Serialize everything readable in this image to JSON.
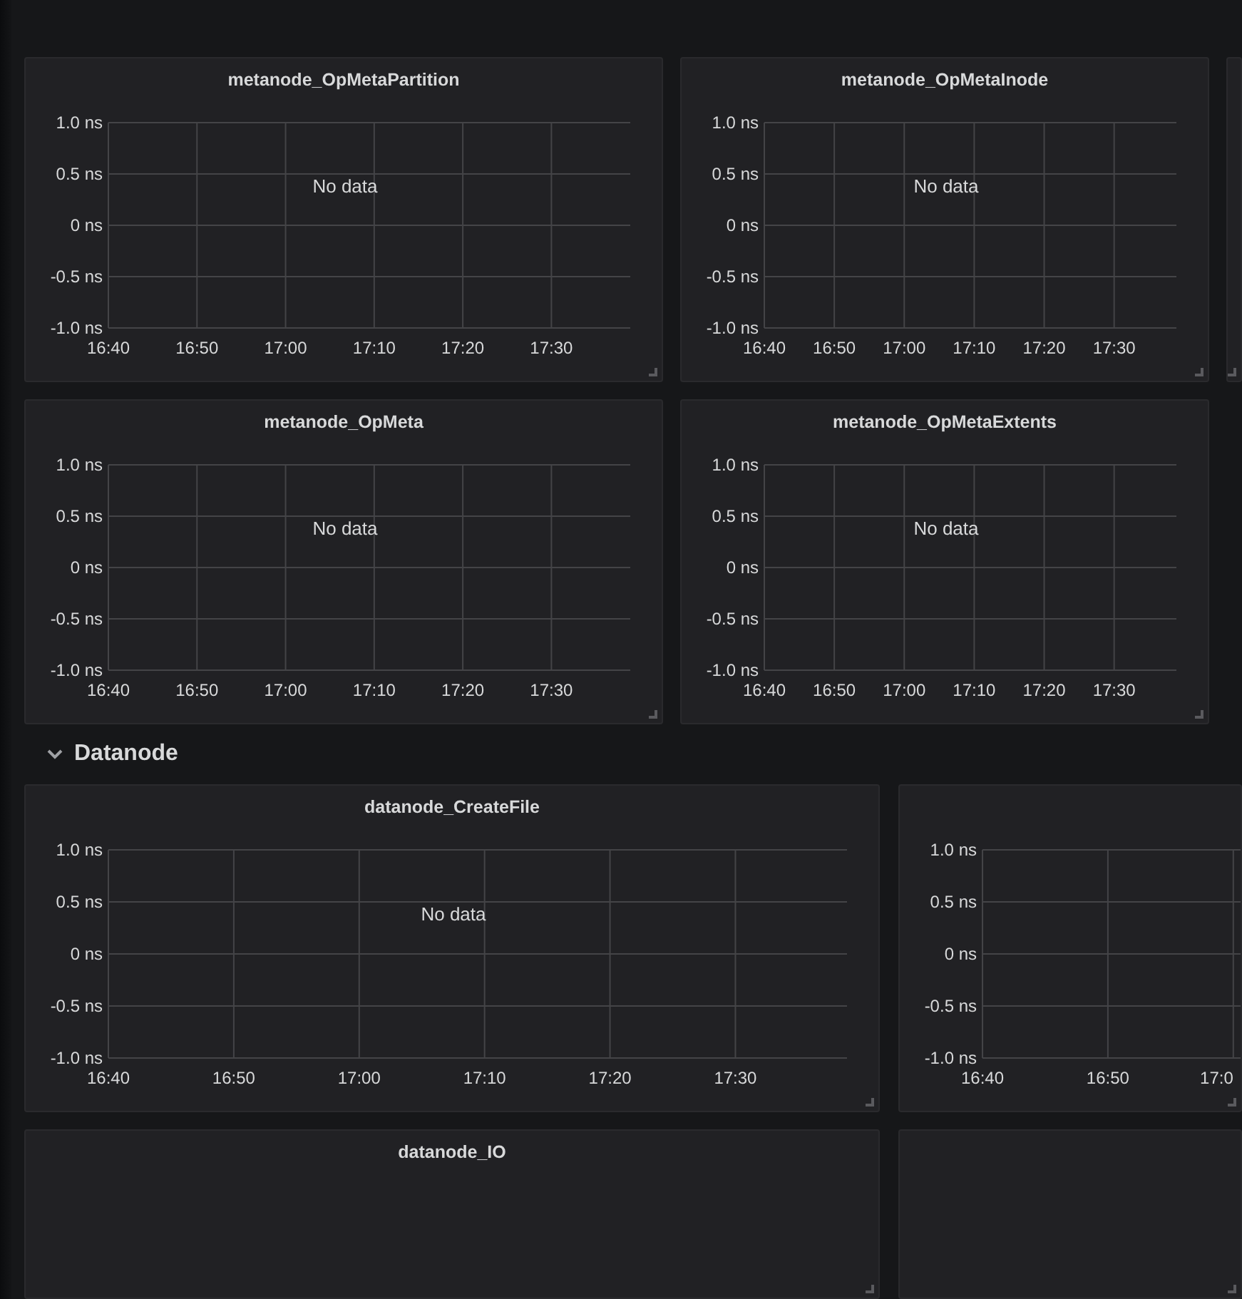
{
  "dashboard": [
    {
      "kind": "panels",
      "panels": [
        {
          "kind": "graph",
          "title": "metanode_OpMetaPartition",
          "message": "No data",
          "chart_data": {
            "type": "line",
            "grid": true,
            "ylim": [
              -1,
              1
            ],
            "categories": [
              "16:40",
              "16:50",
              "17:00",
              "17:10",
              "17:20",
              "17:30"
            ],
            "yticks": [
              {
                "value": 1,
                "label": "1.0 ns"
              },
              {
                "value": 0.5,
                "label": "0.5 ns"
              },
              {
                "value": 0,
                "label": "0 ns"
              },
              {
                "value": -0.5,
                "label": "-0.5 ns"
              },
              {
                "value": -1,
                "label": "-1.0 ns"
              }
            ]
          }
        },
        {
          "kind": "graph",
          "title": "metanode_OpMetaInode",
          "message": "No data",
          "chart_data": {
            "type": "line",
            "grid": true,
            "ylim": [
              -1,
              1
            ],
            "categories": [
              "16:40",
              "16:50",
              "17:00",
              "17:10",
              "17:20",
              "17:30"
            ],
            "yticks": [
              {
                "value": 1,
                "label": "1.0 ns"
              },
              {
                "value": 0.5,
                "label": "0.5 ns"
              },
              {
                "value": 0,
                "label": "0 ns"
              },
              {
                "value": -0.5,
                "label": "-0.5 ns"
              },
              {
                "value": -1,
                "label": "-1.0 ns"
              }
            ]
          }
        },
        {
          "kind": "blank"
        }
      ]
    },
    {
      "kind": "panels",
      "panels": [
        {
          "kind": "graph",
          "title": "metanode_OpMeta",
          "message": "No data",
          "chart_data": {
            "type": "line",
            "grid": true,
            "ylim": [
              -1,
              1
            ],
            "categories": [
              "16:40",
              "16:50",
              "17:00",
              "17:10",
              "17:20",
              "17:30"
            ],
            "yticks": [
              {
                "value": 1,
                "label": "1.0 ns"
              },
              {
                "value": 0.5,
                "label": "0.5 ns"
              },
              {
                "value": 0,
                "label": "0 ns"
              },
              {
                "value": -0.5,
                "label": "-0.5 ns"
              },
              {
                "value": -1,
                "label": "-1.0 ns"
              }
            ]
          }
        },
        {
          "kind": "graph",
          "title": "metanode_OpMetaExtents",
          "message": "No data",
          "chart_data": {
            "type": "line",
            "grid": true,
            "ylim": [
              -1,
              1
            ],
            "categories": [
              "16:40",
              "16:50",
              "17:00",
              "17:10",
              "17:20",
              "17:30"
            ],
            "yticks": [
              {
                "value": 1,
                "label": "1.0 ns"
              },
              {
                "value": 0.5,
                "label": "0.5 ns"
              },
              {
                "value": 0,
                "label": "0 ns"
              },
              {
                "value": -0.5,
                "label": "-0.5 ns"
              },
              {
                "value": -1,
                "label": "-1.0 ns"
              }
            ]
          }
        }
      ]
    },
    {
      "kind": "row_header",
      "title": "Datanode",
      "expanded": true
    },
    {
      "kind": "panels",
      "panels": [
        {
          "kind": "graph",
          "title": "datanode_CreateFile",
          "message": "No data",
          "chart_data": {
            "type": "line",
            "grid": true,
            "ylim": [
              -1,
              1
            ],
            "categories": [
              "16:40",
              "16:50",
              "17:00",
              "17:10",
              "17:20",
              "17:30"
            ],
            "yticks": [
              {
                "value": 1,
                "label": "1.0 ns"
              },
              {
                "value": 0.5,
                "label": "0.5 ns"
              },
              {
                "value": 0,
                "label": "0 ns"
              },
              {
                "value": -0.5,
                "label": "-0.5 ns"
              },
              {
                "value": -1,
                "label": "-1.0 ns"
              }
            ]
          }
        },
        {
          "kind": "graph",
          "chart_data": {
            "type": "line",
            "grid": true,
            "ylim": [
              -1,
              1
            ],
            "categories": [
              "16:40",
              "16:50",
              "17:0"
            ],
            "yticks": [
              {
                "value": 1,
                "label": "1.0 ns"
              },
              {
                "value": 0.5,
                "label": "0.5 ns"
              },
              {
                "value": 0,
                "label": "0 ns"
              },
              {
                "value": -0.5,
                "label": "-0.5 ns"
              },
              {
                "value": -1,
                "label": "-1.0 ns"
              }
            ]
          }
        }
      ]
    },
    {
      "kind": "panels",
      "panels": [
        {
          "kind": "blank",
          "title": "datanode_IO"
        },
        {
          "kind": "blank"
        }
      ]
    }
  ]
}
